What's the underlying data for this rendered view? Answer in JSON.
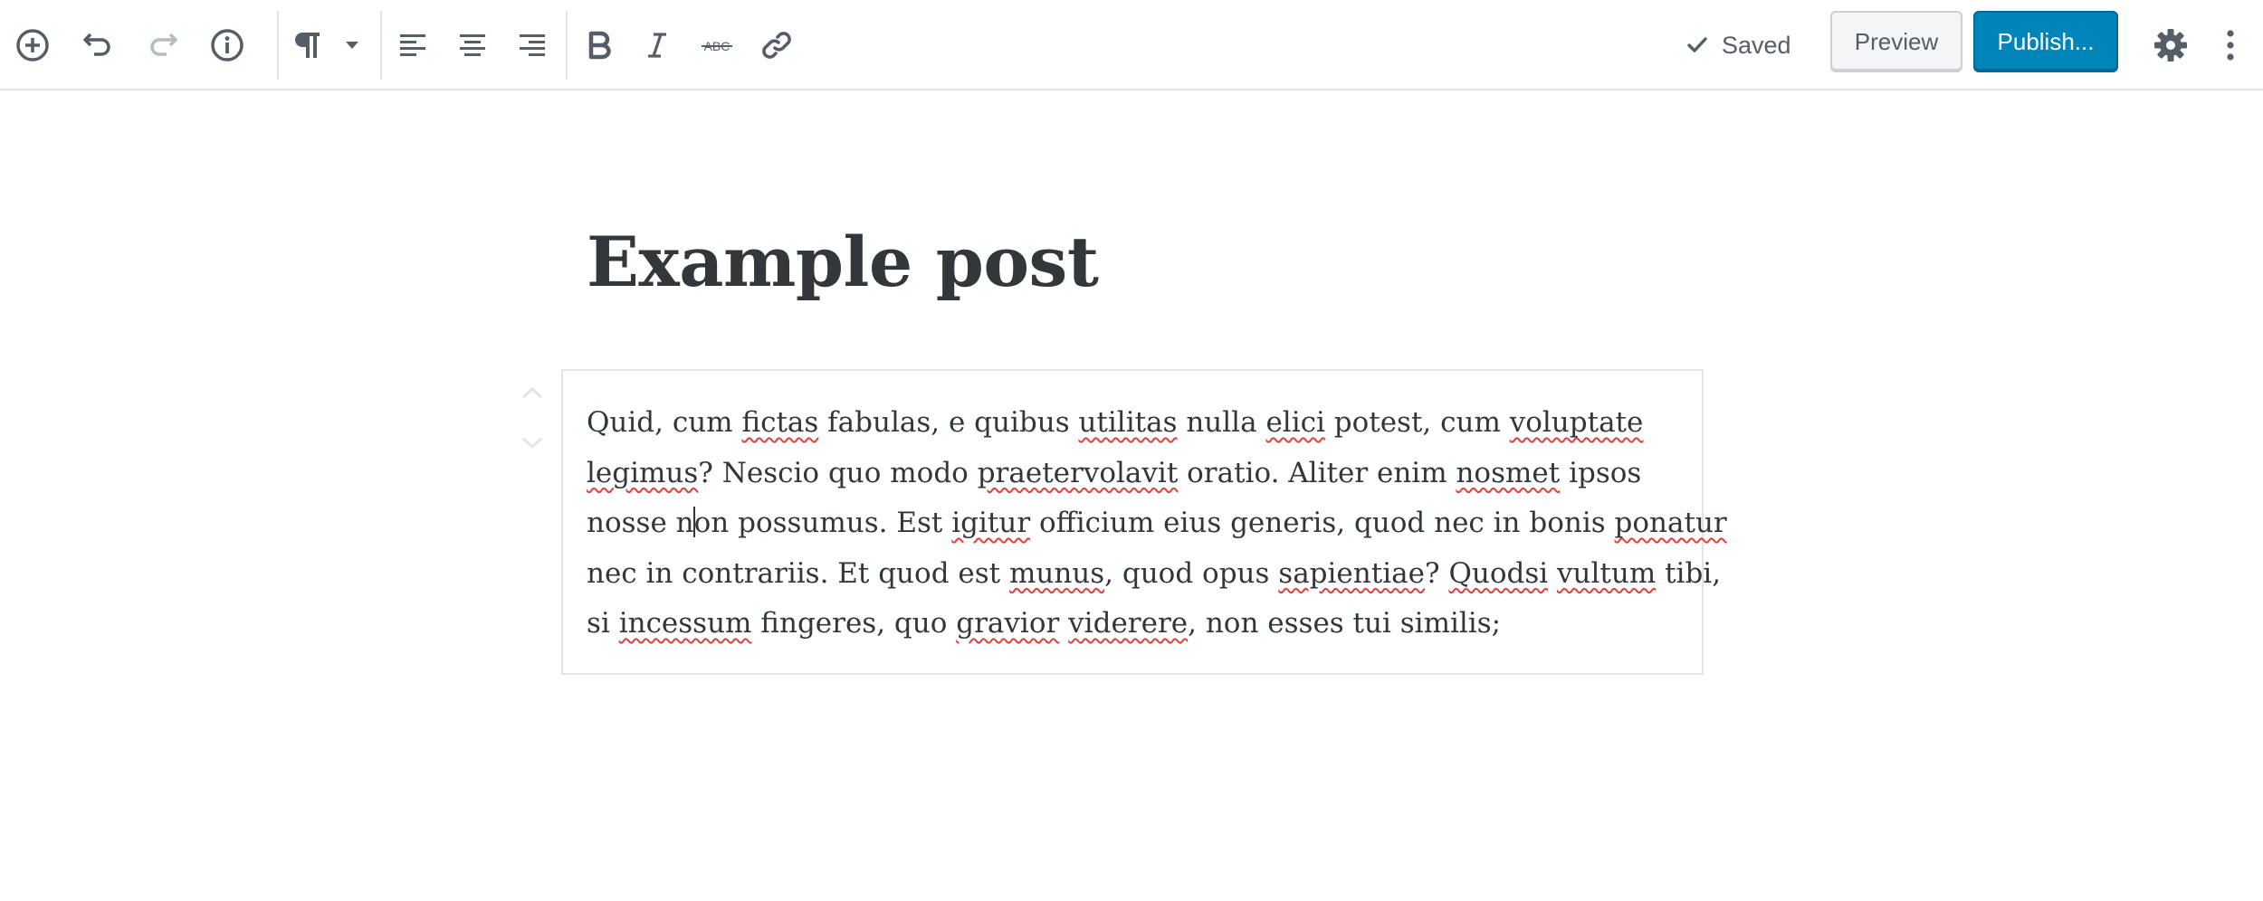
{
  "toolbar": {
    "icons": [
      "add-block-icon",
      "undo-icon",
      "redo-icon",
      "info-icon",
      "paragraph-icon",
      "chevron-down-icon",
      "align-left-icon",
      "align-center-icon",
      "align-right-icon",
      "bold-icon",
      "italic-icon",
      "strikethrough-icon",
      "link-icon",
      "gear-icon",
      "more-vertical-icon",
      "checkmark-icon"
    ],
    "strikethrough_glyph": "ABC",
    "saved_label": "Saved",
    "preview_label": "Preview",
    "publish_label": "Publish...",
    "colors": {
      "primary": "#0085ba",
      "icon": "#555d66",
      "disabled_icon": "#b5bcc2"
    }
  },
  "post": {
    "title": "Example post",
    "paragraph": {
      "lines": [
        [
          {
            "t": "Quid, cum "
          },
          {
            "t": "fictas",
            "s": true
          },
          {
            "t": " fabulas, e quibus "
          },
          {
            "t": "utilitas",
            "s": true
          },
          {
            "t": " nulla "
          },
          {
            "t": "elici",
            "s": true
          },
          {
            "t": " potest, cum "
          },
          {
            "t": "voluptate",
            "s": true
          }
        ],
        [
          {
            "t": "legimus",
            "s": true
          },
          {
            "t": "? Nescio quo modo "
          },
          {
            "t": "praetervolavit",
            "s": true
          },
          {
            "t": " oratio. Aliter enim "
          },
          {
            "t": "nosmet",
            "s": true
          },
          {
            "t": " ipsos"
          }
        ],
        [
          {
            "t": "nosse n"
          },
          {
            "caret": true
          },
          {
            "t": "on possumus. Est "
          },
          {
            "t": "igitur",
            "s": true
          },
          {
            "t": " officium eius generis, quod nec in bonis "
          },
          {
            "t": "ponatur",
            "s": true
          }
        ],
        [
          {
            "t": "nec in contrariis. Et quod est "
          },
          {
            "t": "munus",
            "s": true
          },
          {
            "t": ", quod opus "
          },
          {
            "t": "sapientiae",
            "s": true
          },
          {
            "t": "? "
          },
          {
            "t": "Quodsi",
            "s": true
          },
          {
            "t": " "
          },
          {
            "t": "vultum",
            "s": true
          },
          {
            "t": " tibi,"
          }
        ],
        [
          {
            "t": "si "
          },
          {
            "t": "incessum",
            "s": true
          },
          {
            "t": " fingeres, quo "
          },
          {
            "t": "gravior",
            "s": true
          },
          {
            "t": " "
          },
          {
            "t": "viderere",
            "s": true
          },
          {
            "t": ", non esses tui similis;"
          }
        ]
      ]
    }
  }
}
